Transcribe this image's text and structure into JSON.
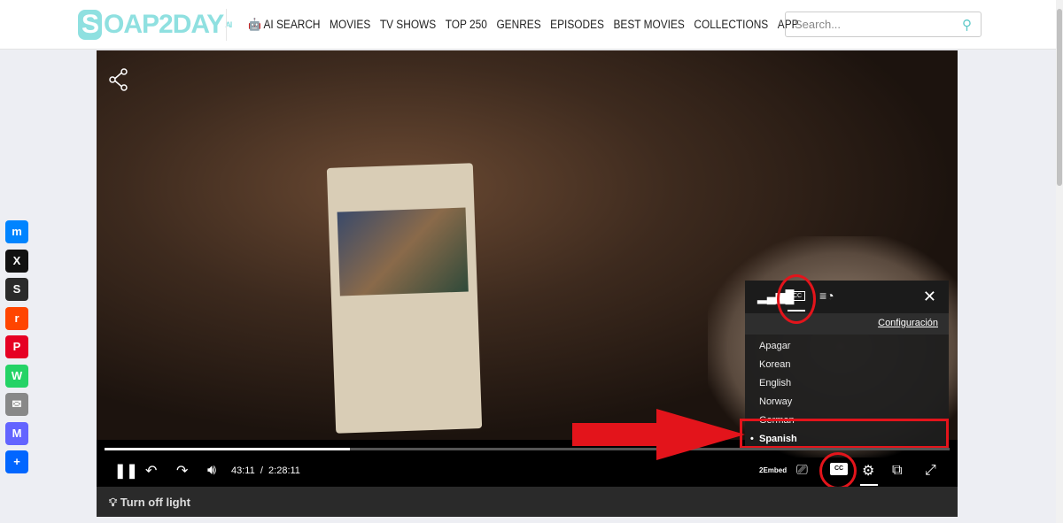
{
  "header": {
    "logo": "SOAP2DAY",
    "logo_suffix": "AI",
    "nav": [
      "AI SEARCH",
      "MOVIES",
      "TV SHOWS",
      "TOP 250",
      "GENRES",
      "EPISODES",
      "BEST MOVIES",
      "COLLECTIONS",
      "APP"
    ],
    "search_placeholder": "Search..."
  },
  "player": {
    "current_time": "43:11",
    "separator": "/",
    "duration": "2:28:11",
    "progress": 0.29,
    "brand": "2Embed",
    "cc_label": "CC"
  },
  "subtitle_menu": {
    "settings_link": "Configuración",
    "options": [
      "Apagar",
      "Korean",
      "English",
      "Norway",
      "German",
      "Spanish"
    ],
    "selected": "Spanish",
    "bullet": "•"
  },
  "light_toggle": "Turn off light",
  "social": [
    {
      "name": "messenger",
      "color": "#0084ff",
      "glyph": "m"
    },
    {
      "name": "x",
      "color": "#111111",
      "glyph": "X"
    },
    {
      "name": "snapchat",
      "color": "#2a2a2a",
      "glyph": "S"
    },
    {
      "name": "reddit",
      "color": "#ff4500",
      "glyph": "r"
    },
    {
      "name": "pinterest",
      "color": "#e60023",
      "glyph": "P"
    },
    {
      "name": "whatsapp",
      "color": "#25d366",
      "glyph": "W"
    },
    {
      "name": "email",
      "color": "#888888",
      "glyph": "✉"
    },
    {
      "name": "mastodon",
      "color": "#6364ff",
      "glyph": "M"
    },
    {
      "name": "share",
      "color": "#0166ff",
      "glyph": "+"
    }
  ],
  "colors": {
    "accent": "#8fe0e0",
    "highlight": "#e3141b"
  }
}
